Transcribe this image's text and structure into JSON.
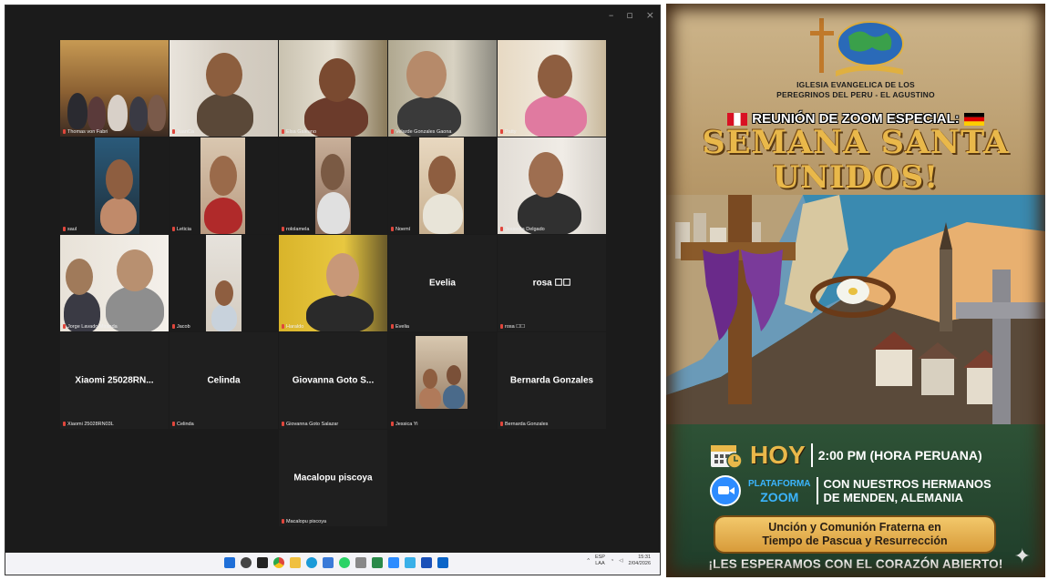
{
  "zoom_window": {
    "controls": [
      "–",
      "▫",
      "×"
    ],
    "participants": [
      {
        "name": "Thomas von Fabri",
        "video": true
      },
      {
        "name": "JuanCa",
        "video": true
      },
      {
        "name": "Elsa Galeano",
        "video": true,
        "active": true
      },
      {
        "name": "Velarde Gonzales Gaona",
        "video": true
      },
      {
        "name": "Patty",
        "video": true
      },
      {
        "name": "saul",
        "video": true
      },
      {
        "name": "Leticia",
        "video": true
      },
      {
        "name": "rololamela",
        "video": true
      },
      {
        "name": "Noemí",
        "video": true
      },
      {
        "name": "Jessenia Delgado",
        "video": true
      },
      {
        "name": "Jorge Lavado Miranda",
        "video": true
      },
      {
        "name": "Jacob",
        "video": true
      },
      {
        "name": "Haraldo",
        "video": true
      },
      {
        "name": "Evelia",
        "video": false,
        "display": "Evelia"
      },
      {
        "name": "rosa ☐☐",
        "video": false,
        "display": "rosa ☐☐"
      },
      {
        "name": "Xiaomi 25028RN03L",
        "video": false,
        "display": "Xiaomi 25028RN..."
      },
      {
        "name": "Celinda",
        "video": false,
        "display": "Celinda"
      },
      {
        "name": "Giovanna Goto Salazar",
        "video": false,
        "display": "Giovanna Goto S..."
      },
      {
        "name": "Jessica Yi",
        "video": true
      },
      {
        "name": "Bernarda Gonzales",
        "video": false,
        "display": "Bernarda Gonzales"
      },
      {
        "name": "Macalopu piscoya",
        "video": false,
        "display": "Macalopu piscoya"
      }
    ],
    "tray": {
      "lang": "ESP",
      "lang2": "LAA",
      "time": "15:31",
      "date": "2/04/2026"
    }
  },
  "poster": {
    "church_line1": "IGLESIA EVANGELICA DE LOS",
    "church_line2": "PEREGRINOS DEL PERU - EL AGUSTINO",
    "reunion": "REUNIÓN DE ZOOM ESPECIAL:",
    "title1": "SEMANA SANTA",
    "title2": "UNIDOS!",
    "hoy": "HOY",
    "time": "2:00 PM (HORA PERUANA)",
    "plataforma": "PLATAFORMA",
    "zoom": "ZOOM",
    "hermanos1": "CON NUESTROS HERMANOS",
    "hermanos2": "DE MENDEN, ALEMANIA",
    "uncion1": "Unción y Comunión Fraterna en",
    "uncion2": "Tiempo de Pascua y Resurrección",
    "esperamos": "¡LES ESPERAMOS CON EL CORAZÓN ABIERTO!",
    "colors": {
      "gold": "#e9b84a",
      "green": "#2e5236",
      "zoom_blue": "#2d8cff"
    }
  }
}
